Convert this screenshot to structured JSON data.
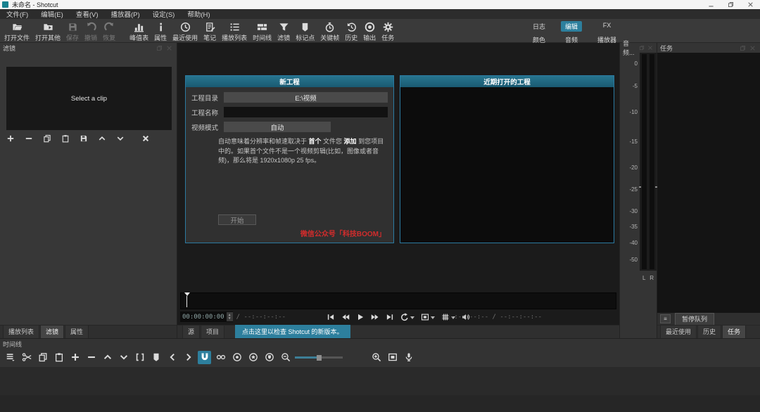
{
  "colors": {
    "accent": "#2d7f9d",
    "dialog_header_teal": "#1e6a80",
    "watermark_red": "#d22c2c"
  },
  "window": {
    "title": "未命名 - Shotcut",
    "controls": [
      {
        "name": "minimize",
        "icon": "win-min"
      },
      {
        "name": "restore",
        "icon": "win-max"
      },
      {
        "name": "close",
        "icon": "win-close"
      }
    ]
  },
  "menubar": {
    "items": [
      {
        "name": "file",
        "label": "文件(F)"
      },
      {
        "name": "edit",
        "label": "编辑(E)"
      },
      {
        "name": "view",
        "label": "查看(V)"
      },
      {
        "name": "player",
        "label": "播放器(P)"
      },
      {
        "name": "settings",
        "label": "设定(S)"
      },
      {
        "name": "help",
        "label": "帮助(H)"
      }
    ]
  },
  "toolbar": {
    "items": [
      {
        "name": "open-file",
        "label": "打开文件",
        "icon": "folder-open",
        "disabled": false
      },
      {
        "name": "open-other",
        "label": "打开其他",
        "icon": "folder-other",
        "disabled": false
      },
      {
        "name": "save",
        "label": "保存",
        "icon": "floppy",
        "disabled": true
      },
      {
        "name": "undo",
        "label": "撤销",
        "icon": "undo",
        "disabled": true
      },
      {
        "name": "redo",
        "label": "恢复",
        "icon": "redo",
        "disabled": true
      },
      {
        "name": "peak-meter",
        "label": "峰值表",
        "icon": "meter",
        "disabled": false,
        "sep": true
      },
      {
        "name": "properties",
        "label": "属性",
        "icon": "info",
        "disabled": false
      },
      {
        "name": "recent",
        "label": "最近使用",
        "icon": "clock",
        "disabled": false
      },
      {
        "name": "notes",
        "label": "笔记",
        "icon": "note",
        "disabled": false
      },
      {
        "name": "playlist",
        "label": "播放列表",
        "icon": "list",
        "disabled": false
      },
      {
        "name": "timeline",
        "label": "时间线",
        "icon": "timeline",
        "disabled": false
      },
      {
        "name": "filters",
        "label": "滤镜",
        "icon": "funnel",
        "disabled": false
      },
      {
        "name": "markers",
        "label": "标记点",
        "icon": "bookmark",
        "disabled": false
      },
      {
        "name": "keyframes",
        "label": "关键帧",
        "icon": "stopwatch",
        "disabled": false
      },
      {
        "name": "history",
        "label": "历史",
        "icon": "history",
        "disabled": false
      },
      {
        "name": "export",
        "label": "输出",
        "icon": "output",
        "disabled": false
      },
      {
        "name": "jobs",
        "label": "任务",
        "icon": "gear",
        "disabled": false
      }
    ],
    "layouts": [
      {
        "name": "logging",
        "label": "日志",
        "active": false
      },
      {
        "name": "editing",
        "label": "编辑",
        "active": true
      },
      {
        "name": "fx",
        "label": "FX",
        "active": false
      },
      {
        "name": "color",
        "label": "颜色",
        "active": false
      },
      {
        "name": "audio",
        "label": "音频",
        "active": false
      },
      {
        "name": "player",
        "label": "播放器",
        "active": false
      }
    ]
  },
  "filters_panel": {
    "title": "滤镜",
    "message": "Select a clip",
    "actions": [
      {
        "name": "add-filter",
        "icon": "plus"
      },
      {
        "name": "remove-filter",
        "icon": "minus"
      },
      {
        "name": "copy-filters",
        "icon": "copy"
      },
      {
        "name": "paste-filters",
        "icon": "paste"
      },
      {
        "name": "save-filter-set",
        "icon": "floppy"
      },
      {
        "name": "move-filter-up",
        "icon": "chev-up"
      },
      {
        "name": "move-filter-down",
        "icon": "chev-down"
      },
      {
        "name": "deselect-filter",
        "icon": "x-bold",
        "gap": true
      }
    ]
  },
  "left_tabs": {
    "items": [
      {
        "name": "playlist",
        "label": "播放列表",
        "active": false
      },
      {
        "name": "filters",
        "label": "滤镜",
        "active": true
      },
      {
        "name": "properties",
        "label": "属性",
        "active": false
      }
    ]
  },
  "new_project_dialog": {
    "title": "新工程",
    "directory_label": "工程目录",
    "directory_value": "E:\\视频",
    "name_label": "工程名称",
    "name_value": "",
    "mode_label": "视频模式",
    "mode_value": "自动",
    "description_segments": [
      {
        "text": "自动意味着分辨率和帧速取决于 "
      },
      {
        "text": "首个",
        "bold": true
      },
      {
        "text": " 文件您 "
      },
      {
        "text": "添加",
        "bold": true
      },
      {
        "text": " 到您项目中的。如果首个文件不是一个视频剪辑(比如，图像或者音频)，那么将是 1920x1080p 25 fps。"
      }
    ],
    "start_label": "开始",
    "watermark": "微信公众号「科技BOOM」"
  },
  "recent_dialog": {
    "title": "近期打开的工程"
  },
  "player": {
    "position": "00:00:00:00",
    "duration": "--:--:--:--",
    "selection_position": "--:--:--:--",
    "selection_duration": "--:--:--:--",
    "transport": [
      {
        "name": "skip-to-start",
        "icon": "skip-start"
      },
      {
        "name": "rewind",
        "icon": "rewind"
      },
      {
        "name": "play",
        "icon": "play"
      },
      {
        "name": "fast-forward",
        "icon": "ff"
      },
      {
        "name": "skip-to-end",
        "icon": "skip-end"
      },
      {
        "name": "loop",
        "icon": "loop",
        "dropdown": true
      },
      {
        "name": "zoom-fit",
        "icon": "fit-sel",
        "dropdown": true
      },
      {
        "name": "grid",
        "icon": "grid",
        "dropdown": true
      },
      {
        "name": "volume",
        "icon": "volume"
      }
    ],
    "tabs": [
      {
        "name": "source",
        "label": "源",
        "active": false
      },
      {
        "name": "project",
        "label": "项目",
        "active": false
      }
    ],
    "update_notice": "点击这里以检查 Shotcut 的新版本。"
  },
  "audio_meter": {
    "title": "音频...",
    "ticks": [
      "0",
      "-5",
      "-10",
      "-15",
      "-20",
      "-25",
      "-30",
      "-35",
      "-40",
      "-50"
    ],
    "channels": [
      "L",
      "R"
    ]
  },
  "jobs_panel": {
    "title": "任务",
    "menu_glyph": "≡",
    "pause_button": "暂停队列",
    "tabs": [
      {
        "name": "recent",
        "label": "最近使用",
        "active": false
      },
      {
        "name": "history",
        "label": "历史",
        "active": false
      },
      {
        "name": "jobs",
        "label": "任务",
        "active": true
      }
    ]
  },
  "timeline": {
    "title": "时间线",
    "zoom_percent": 45,
    "tools": [
      {
        "name": "timeline-menu",
        "icon": "tl-menu"
      },
      {
        "name": "cut",
        "icon": "scissors"
      },
      {
        "name": "copy",
        "icon": "copy"
      },
      {
        "name": "paste",
        "icon": "paste"
      },
      {
        "name": "append",
        "icon": "plus"
      },
      {
        "name": "ripple-delete",
        "icon": "minus"
      },
      {
        "name": "lift",
        "icon": "chev-up"
      },
      {
        "name": "overwrite",
        "icon": "chev-down"
      },
      {
        "name": "split",
        "icon": "split"
      },
      {
        "name": "marker",
        "icon": "bookmark"
      },
      {
        "name": "previous-marker",
        "icon": "chev-left"
      },
      {
        "name": "next-marker",
        "icon": "chev-right"
      },
      {
        "name": "snap",
        "icon": "magnet",
        "active": true
      },
      {
        "name": "scrub-while-dragging",
        "icon": "scrub"
      },
      {
        "name": "ripple",
        "icon": "ripple"
      },
      {
        "name": "ripple-all-tracks",
        "icon": "ripple-all"
      },
      {
        "name": "ripple-markers",
        "icon": "ripple-markers"
      },
      {
        "name": "zoom-out",
        "icon": "zoom-out"
      },
      {
        "name": "zoom-slider",
        "slider": true
      },
      {
        "name": "zoom-in",
        "icon": "zoom-in",
        "gap": true
      },
      {
        "name": "zoom-timeline-fit",
        "icon": "fit-sel"
      },
      {
        "name": "record-audio",
        "icon": "mic"
      }
    ]
  }
}
